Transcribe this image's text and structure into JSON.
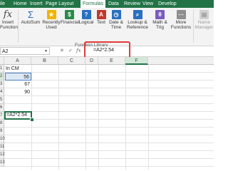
{
  "tabs": [
    "ile",
    "Home",
    "Insert",
    "Page Layout",
    "Formulas",
    "Data",
    "Review",
    "View",
    "Develop"
  ],
  "active_tab": "Formulas",
  "ribbon": {
    "insert_function": [
      "Insert",
      "Function"
    ],
    "autosum": "AutoSum",
    "recently_used": [
      "Recently",
      "Used"
    ],
    "financial": "Financial",
    "logical": "Logical",
    "text": "Text",
    "date_time": [
      "Date &",
      "Time"
    ],
    "lookup_reference": [
      "Lookup &",
      "Reference"
    ],
    "math_trig": [
      "Math &",
      "Trig"
    ],
    "more_functions": [
      "More",
      "Functions"
    ],
    "name_manager": [
      "Name",
      "Manager"
    ],
    "group_label": "Function Library",
    "fx_symbol": "fx",
    "sigma_symbol": "Σ"
  },
  "formula_bar": {
    "name_box": "A2",
    "cancel": "✕",
    "enter": "✓",
    "fx": "fx",
    "formula": "=A2*2.54"
  },
  "grid": {
    "columns": [
      "A",
      "B",
      "C",
      "D",
      "E",
      "F"
    ],
    "selected_column": "F",
    "row_numbers": [
      "1",
      "2",
      "3",
      "4",
      "5",
      "6",
      "7",
      "8",
      "9",
      "10",
      "11",
      "12",
      "13"
    ],
    "a1": "In CM",
    "a2": "56",
    "a3": "67",
    "a4": "90",
    "a7": "=A2*2.54"
  },
  "colors": {
    "ribbon_green": "#217346",
    "highlight_red": "#e23c3c"
  }
}
